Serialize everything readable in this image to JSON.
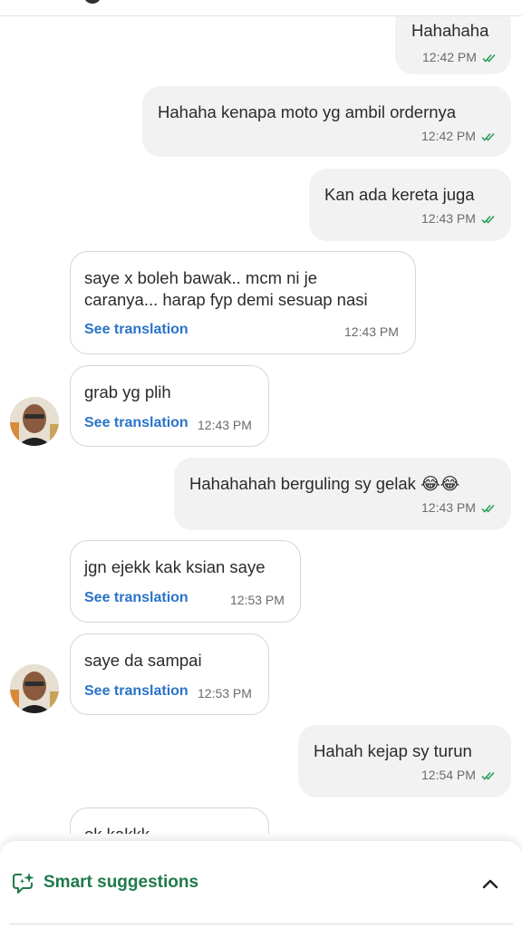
{
  "messages": [
    {
      "text": "Hahahaha",
      "time": "12:42 PM"
    },
    {
      "text": "Hahaha kenapa moto yg ambil ordernya",
      "time": "12:42 PM"
    },
    {
      "text": "Kan ada kereta juga",
      "time": "12:43 PM"
    },
    {
      "line1": "saye x boleh bawak.. mcm ni je",
      "line2": "caranya... harap fyp demi sesuap nasi",
      "translate": "See translation",
      "time": "12:43 PM"
    },
    {
      "text": "grab yg plih",
      "translate": "See translation",
      "time": "12:43 PM"
    },
    {
      "text": "Hahahahah berguling sy gelak 😂😂",
      "time": "12:43 PM"
    },
    {
      "text": "jgn ejekk kak ksian saye",
      "translate": "See translation",
      "time": "12:53 PM"
    },
    {
      "text": "saye da sampai",
      "translate": "See translation",
      "time": "12:53 PM"
    },
    {
      "text": "Hahah kejap sy turun",
      "time": "12:54 PM"
    },
    {
      "text": "ok kakkk"
    }
  ],
  "smart_suggestions": {
    "label": "Smart suggestions",
    "icon": "sparkle-chat-icon",
    "toggle_icon": "chevron-up-icon"
  },
  "colors": {
    "accent_green": "#1f7a4c",
    "link_blue": "#2a73c7",
    "read_tick": "#2e9e5e",
    "outgoing_bubble": "#f2f2f2"
  }
}
